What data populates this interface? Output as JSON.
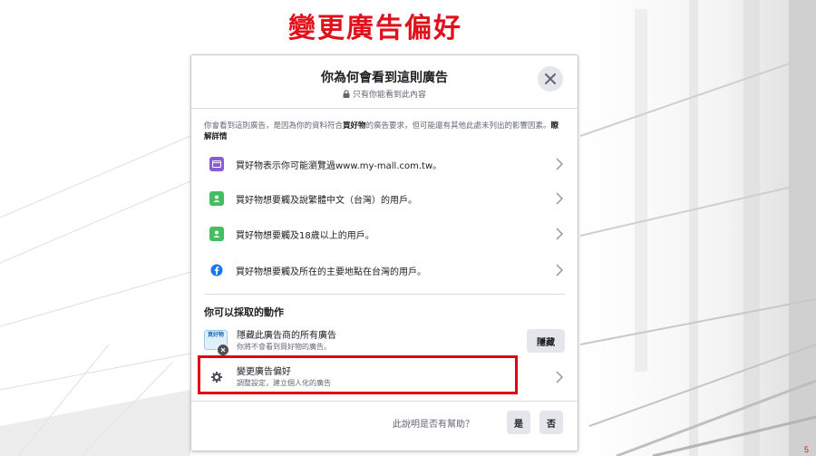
{
  "slide": {
    "title": "變更廣告偏好",
    "page_number": "5"
  },
  "dialog": {
    "title": "你為何會看到這則廣告",
    "subtitle": "只有你能看到此內容",
    "intro_prefix": "你會看到這則廣告，是因為你的資料符合",
    "intro_advertiser": "買好物",
    "intro_middle": "的廣告要求，但可能還有其他此處未列出的影響因素。",
    "intro_link": "瞭解詳情",
    "reasons": [
      {
        "text": "買好物表示你可能瀏覽過www.my-mall.com.tw。",
        "icon": "website-icon",
        "color": "#8a5cd6"
      },
      {
        "text": "買好物想要觸及說繁體中文（台灣）的用戶。",
        "icon": "person-icon",
        "color": "#45bd62"
      },
      {
        "text": "買好物想要觸及18歲以上的用戶。",
        "icon": "person-icon",
        "color": "#45bd62"
      },
      {
        "text": "買好物想要觸及所在的主要地點在台灣的用戶。",
        "icon": "facebook-icon",
        "color": "#1877f2"
      }
    ],
    "actions_title": "你可以採取的動作",
    "hide_action": {
      "title": "隱藏此廣告商的所有廣告",
      "subtitle": "你將不會看到買好物的廣告。",
      "button": "隱藏",
      "logo_text": "買好物"
    },
    "prefs_action": {
      "title": "變更廣告偏好",
      "subtitle": "調整設定，建立個人化的廣告"
    },
    "feedback": {
      "question": "此說明是否有幫助？",
      "yes": "是",
      "no": "否"
    }
  },
  "colors": {
    "highlight": "#e00012",
    "title_red": "#e0111b",
    "button_gray": "#e4e6eb"
  }
}
